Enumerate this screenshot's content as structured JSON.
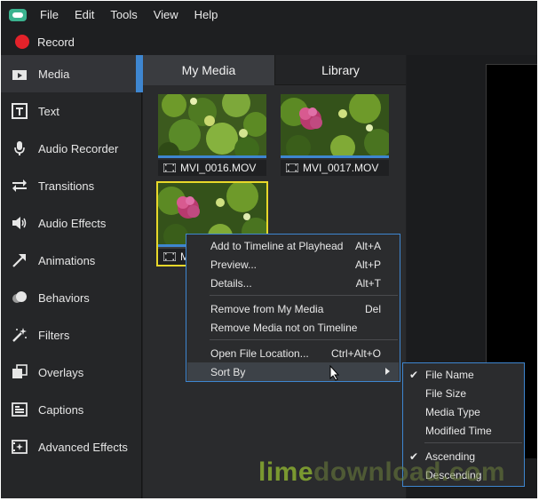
{
  "menubar": {
    "items": [
      "File",
      "Edit",
      "Tools",
      "View",
      "Help"
    ]
  },
  "record": {
    "label": "Record"
  },
  "sidebar": {
    "items": [
      {
        "label": "Media",
        "icon": "media-icon",
        "active": true
      },
      {
        "label": "Text",
        "icon": "text-icon"
      },
      {
        "label": "Audio Recorder",
        "icon": "microphone-icon"
      },
      {
        "label": "Transitions",
        "icon": "transitions-icon"
      },
      {
        "label": "Audio Effects",
        "icon": "speaker-icon"
      },
      {
        "label": "Animations",
        "icon": "arrow-icon"
      },
      {
        "label": "Behaviors",
        "icon": "behaviors-icon"
      },
      {
        "label": "Filters",
        "icon": "magic-wand-icon"
      },
      {
        "label": "Overlays",
        "icon": "overlays-icon"
      },
      {
        "label": "Captions",
        "icon": "captions-icon"
      },
      {
        "label": "Advanced Effects",
        "icon": "advanced-effects-icon"
      }
    ]
  },
  "tabs": {
    "my_media": "My Media",
    "library": "Library"
  },
  "media": {
    "items": [
      {
        "name": "MVI_0016.MOV"
      },
      {
        "name": "MVI_0017.MOV"
      },
      {
        "name": "M"
      }
    ]
  },
  "context_menu": {
    "items": [
      {
        "label": "Add to Timeline at Playhead",
        "shortcut": "Alt+A"
      },
      {
        "label": "Preview...",
        "shortcut": "Alt+P"
      },
      {
        "label": "Details...",
        "shortcut": "Alt+T"
      },
      {
        "label": "Remove from My Media",
        "shortcut": "Del"
      },
      {
        "label": "Remove Media not on Timeline",
        "shortcut": ""
      },
      {
        "label": "Open File Location...",
        "shortcut": "Ctrl+Alt+O"
      },
      {
        "label": "Sort By",
        "shortcut": ""
      }
    ]
  },
  "sort_submenu": {
    "items": [
      {
        "label": "File Name",
        "checked": true
      },
      {
        "label": "File Size",
        "checked": false
      },
      {
        "label": "Media Type",
        "checked": false
      },
      {
        "label": "Modified Time",
        "checked": false
      },
      {
        "label": "Ascending",
        "checked": true
      },
      {
        "label": "Descending",
        "checked": false
      }
    ],
    "check_glyph": "✔"
  },
  "watermark": {
    "part1": "lime",
    "part2": "download.com"
  },
  "colors": {
    "accent": "#3e86d0",
    "selection": "#e8d82a",
    "record": "#e3222a"
  }
}
